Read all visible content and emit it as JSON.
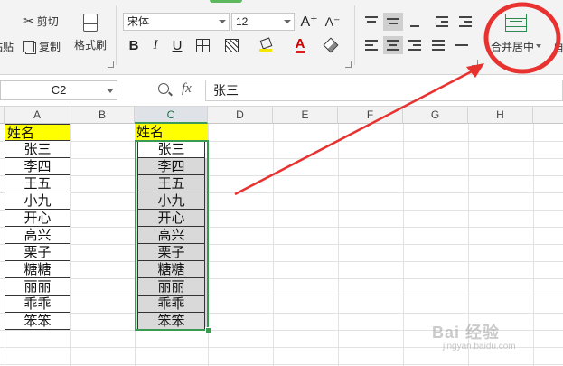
{
  "ribbon": {
    "clipboard": {
      "paste_label": "粘贴",
      "cut_label": "剪切",
      "copy_label": "复制",
      "format_painter_label": "格式刷"
    },
    "font": {
      "family": "宋体",
      "size": "12",
      "grow_label": "A⁺",
      "shrink_label": "A⁻",
      "bold": "B",
      "italic": "I",
      "underline": "U",
      "font_color_label": "A"
    },
    "merge": {
      "label": "合并居中",
      "next_partial": "自"
    }
  },
  "formula_bar": {
    "cell_ref": "C2",
    "fx_label": "fx",
    "value": "张三"
  },
  "sheet": {
    "columns": [
      "A",
      "B",
      "C",
      "D",
      "E",
      "F",
      "G",
      "H"
    ],
    "selected_column": "C",
    "header_text": "姓名",
    "column_a": [
      "张三",
      "李四",
      "王五",
      "小九",
      "开心",
      "高兴",
      "栗子",
      "糖糖",
      "丽丽",
      "乖乖",
      "笨笨"
    ],
    "column_c": [
      "张三",
      "李四",
      "王五",
      "小九",
      "开心",
      "高兴",
      "栗子",
      "糖糖",
      "丽丽",
      "乖乖",
      "笨笨"
    ]
  },
  "colors": {
    "accent_green": "#3a9a52",
    "highlight_yellow": "#ffff00",
    "annotation_red": "#e8322f",
    "merged_cell_gray": "#d9d9d9"
  },
  "watermark": {
    "text": "Bai 经验",
    "url": "jingyan.baidu.com"
  }
}
